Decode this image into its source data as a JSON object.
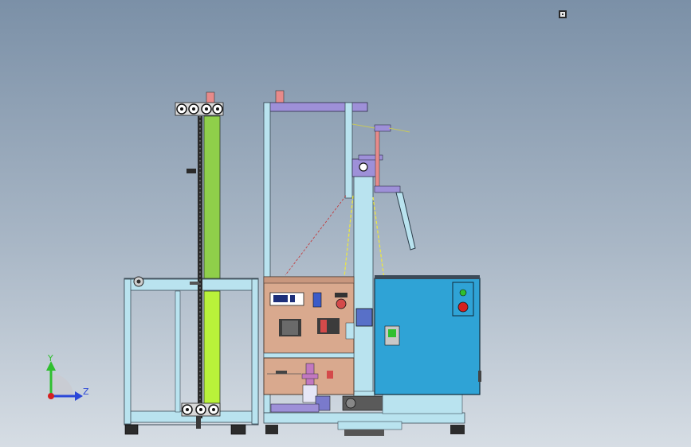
{
  "viewport": {
    "background_top": "#7b90a7",
    "background_bottom": "#d6dde4"
  },
  "triad": {
    "y_label": "Y",
    "z_label": "Z",
    "y_color": "#2fbf2f",
    "z_color": "#2b47d8",
    "x_color": "#d42020"
  },
  "palette": {
    "frame": "#b9e3ef",
    "frame_dark": "#89b9c8",
    "green_guide": "#8fcf4a",
    "green_guide_light": "#b9f23a",
    "purple": "#9e90d8",
    "red_pin": "#e78a8a",
    "copper_panel": "#d9a98e",
    "cabinet": "#2fa3d6",
    "dark": "#3a3a3a"
  },
  "icons": {
    "view_cursor": "view-orientation-icon",
    "emergency_stop": "emergency-stop-icon",
    "green_indicator": "indicator-light-icon"
  }
}
